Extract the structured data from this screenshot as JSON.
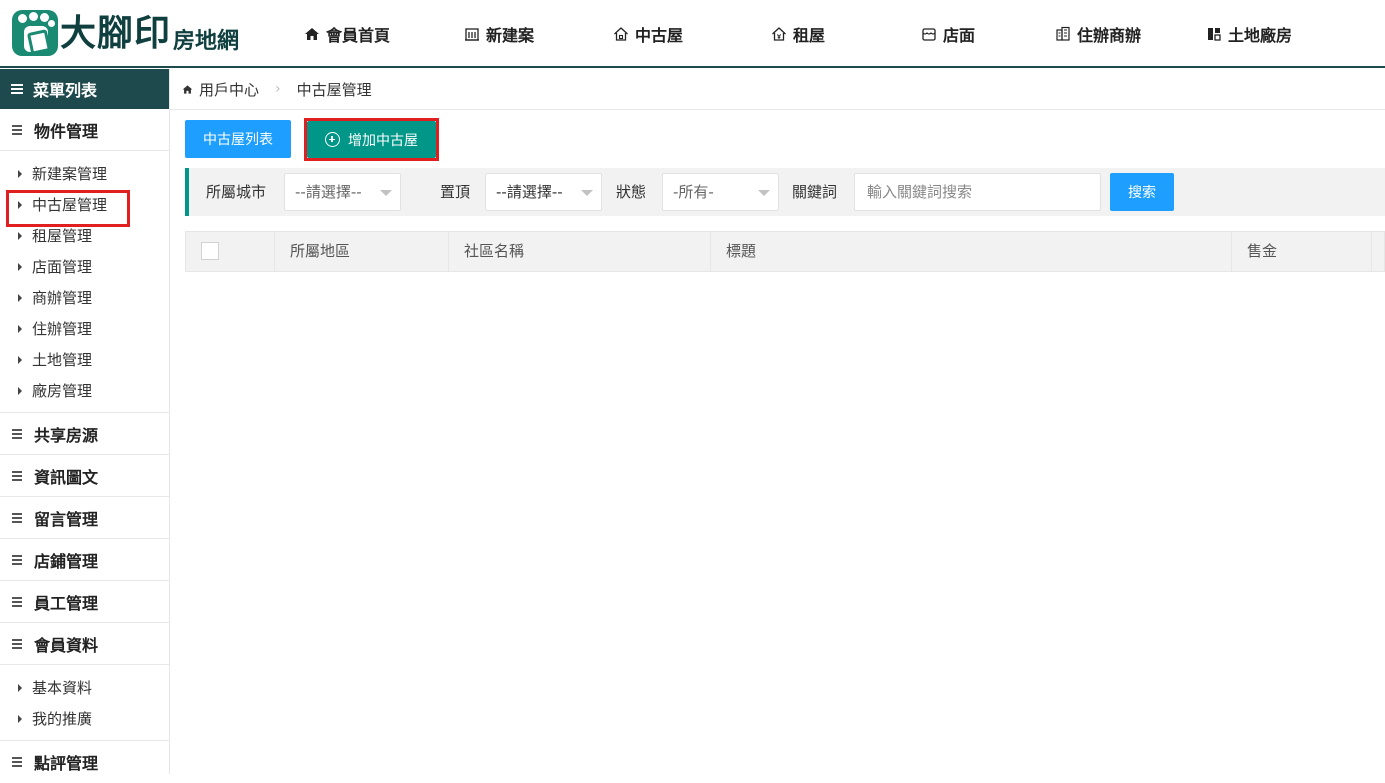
{
  "header": {
    "logo_main": "大腳印",
    "logo_sub": "房地網",
    "nav": [
      {
        "label": "會員首頁",
        "icon": "home-icon"
      },
      {
        "label": "新建案",
        "icon": "building-icon"
      },
      {
        "label": "中古屋",
        "icon": "house-icon"
      },
      {
        "label": "租屋",
        "icon": "rent-house-icon"
      },
      {
        "label": "店面",
        "icon": "shop-icon"
      },
      {
        "label": "住辦商辦",
        "icon": "office-icon"
      },
      {
        "label": "土地廠房",
        "icon": "land-icon"
      }
    ]
  },
  "sidebar": {
    "title": "菜單列表",
    "groups": {
      "property": "物件管理",
      "property_items": [
        "新建案管理",
        "中古屋管理",
        "租屋管理",
        "店面管理",
        "商辦管理",
        "住辦管理",
        "土地管理",
        "廠房管理"
      ],
      "shared": "共享房源",
      "news": "資訊圖文",
      "messages": "留言管理",
      "stores": "店鋪管理",
      "staff": "員工管理",
      "member": "會員資料",
      "member_items": [
        "基本資料",
        "我的推廣"
      ],
      "reviews": "點評管理"
    },
    "active_item": "中古屋管理"
  },
  "breadcrumb": {
    "home": "用戶中心",
    "current": "中古屋管理"
  },
  "actions": {
    "list_label": "中古屋列表",
    "add_label": "增加中古屋"
  },
  "filter": {
    "city_label": "所屬城市",
    "city_value": "--請選擇--",
    "top_label": "置頂",
    "top_value": "--請選擇--",
    "status_label": "狀態",
    "status_value": "-所有-",
    "keyword_label": "關鍵詞",
    "keyword_placeholder": "輸入關鍵詞搜索",
    "search_label": "搜索"
  },
  "table": {
    "columns": [
      "所屬地區",
      "社區名稱",
      "標題",
      "售金"
    ]
  },
  "colors": {
    "header_dark": "#1f4a4d",
    "primary_blue": "#1e9fff",
    "primary_green": "#009688",
    "highlight_red": "#e02020"
  }
}
